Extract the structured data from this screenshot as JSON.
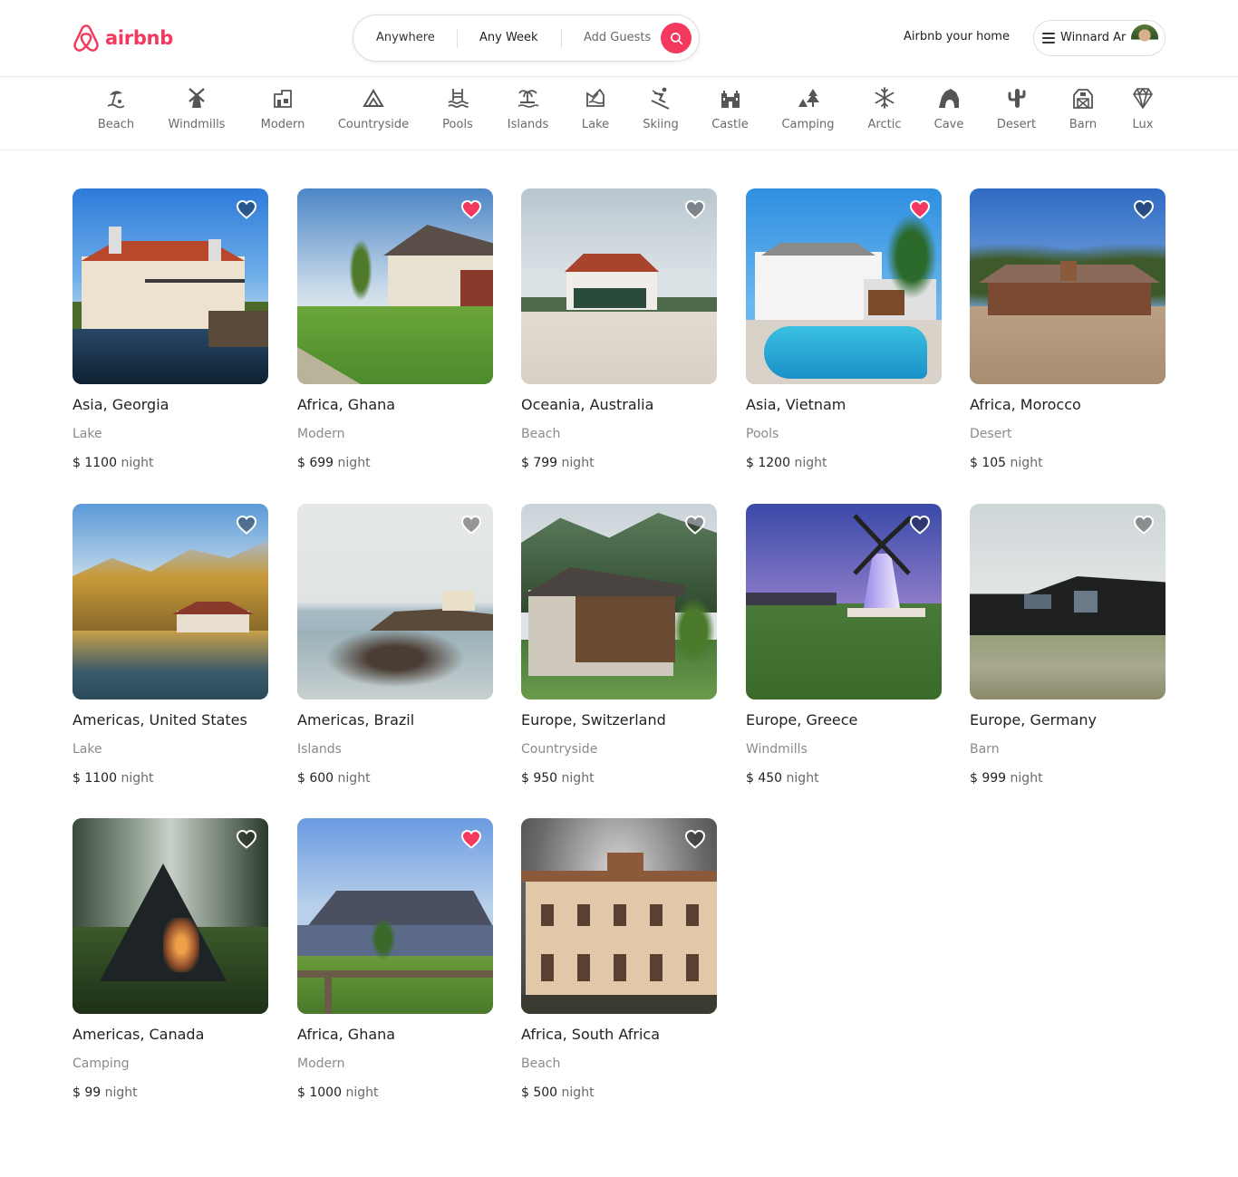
{
  "brand": {
    "name": "airbnb",
    "color": "#f5385d"
  },
  "search": {
    "anywhere": "Anywhere",
    "week": "Any Week",
    "guests": "Add Guests",
    "icon": "search-icon"
  },
  "header": {
    "host_link": "Airbnb your home",
    "user_name": "Winnard Ar",
    "menu_icon": "hamburger-icon"
  },
  "categories": [
    {
      "label": "Beach",
      "icon": "beach-icon"
    },
    {
      "label": "Windmills",
      "icon": "windmill-icon"
    },
    {
      "label": "Modern",
      "icon": "modern-house-icon"
    },
    {
      "label": "Countryside",
      "icon": "mountain-icon"
    },
    {
      "label": "Pools",
      "icon": "pool-icon"
    },
    {
      "label": "Islands",
      "icon": "island-icon"
    },
    {
      "label": "Lake",
      "icon": "lake-icon"
    },
    {
      "label": "Skiing",
      "icon": "skiing-icon"
    },
    {
      "label": "Castle",
      "icon": "castle-icon"
    },
    {
      "label": "Camping",
      "icon": "camping-icon"
    },
    {
      "label": "Arctic",
      "icon": "snowflake-icon"
    },
    {
      "label": "Cave",
      "icon": "cave-icon"
    },
    {
      "label": "Desert",
      "icon": "cactus-icon"
    },
    {
      "label": "Barn",
      "icon": "barn-icon"
    },
    {
      "label": "Lux",
      "icon": "diamond-icon"
    }
  ],
  "listings": [
    {
      "location": "Asia, Georgia",
      "category": "Lake",
      "price": "$ 1100",
      "unit": "night",
      "favorite": false
    },
    {
      "location": "Africa, Ghana",
      "category": "Modern",
      "price": "$ 699",
      "unit": "night",
      "favorite": true
    },
    {
      "location": "Oceania, Australia",
      "category": "Beach",
      "price": "$ 799",
      "unit": "night",
      "favorite": false
    },
    {
      "location": "Asia, Vietnam",
      "category": "Pools",
      "price": "$ 1200",
      "unit": "night",
      "favorite": true
    },
    {
      "location": "Africa, Morocco",
      "category": "Desert",
      "price": "$ 105",
      "unit": "night",
      "favorite": false
    },
    {
      "location": "Americas, United States",
      "category": "Lake",
      "price": "$ 1100",
      "unit": "night",
      "favorite": false
    },
    {
      "location": "Americas, Brazil",
      "category": "Islands",
      "price": "$ 600",
      "unit": "night",
      "favorite": false
    },
    {
      "location": "Europe, Switzerland",
      "category": "Countryside",
      "price": "$ 950",
      "unit": "night",
      "favorite": false
    },
    {
      "location": "Europe, Greece",
      "category": "Windmills",
      "price": "$ 450",
      "unit": "night",
      "favorite": false
    },
    {
      "location": "Europe, Germany",
      "category": "Barn",
      "price": "$ 999",
      "unit": "night",
      "favorite": false
    },
    {
      "location": "Americas, Canada",
      "category": "Camping",
      "price": "$ 99",
      "unit": "night",
      "favorite": false
    },
    {
      "location": "Africa, Ghana",
      "category": "Modern",
      "price": "$ 1000",
      "unit": "night",
      "favorite": true
    },
    {
      "location": "Africa, South Africa",
      "category": "Beach",
      "price": "$ 500",
      "unit": "night",
      "favorite": false
    }
  ],
  "colors": {
    "favorite_heart": "#f5385d",
    "muted_text": "#8a8a8a"
  }
}
